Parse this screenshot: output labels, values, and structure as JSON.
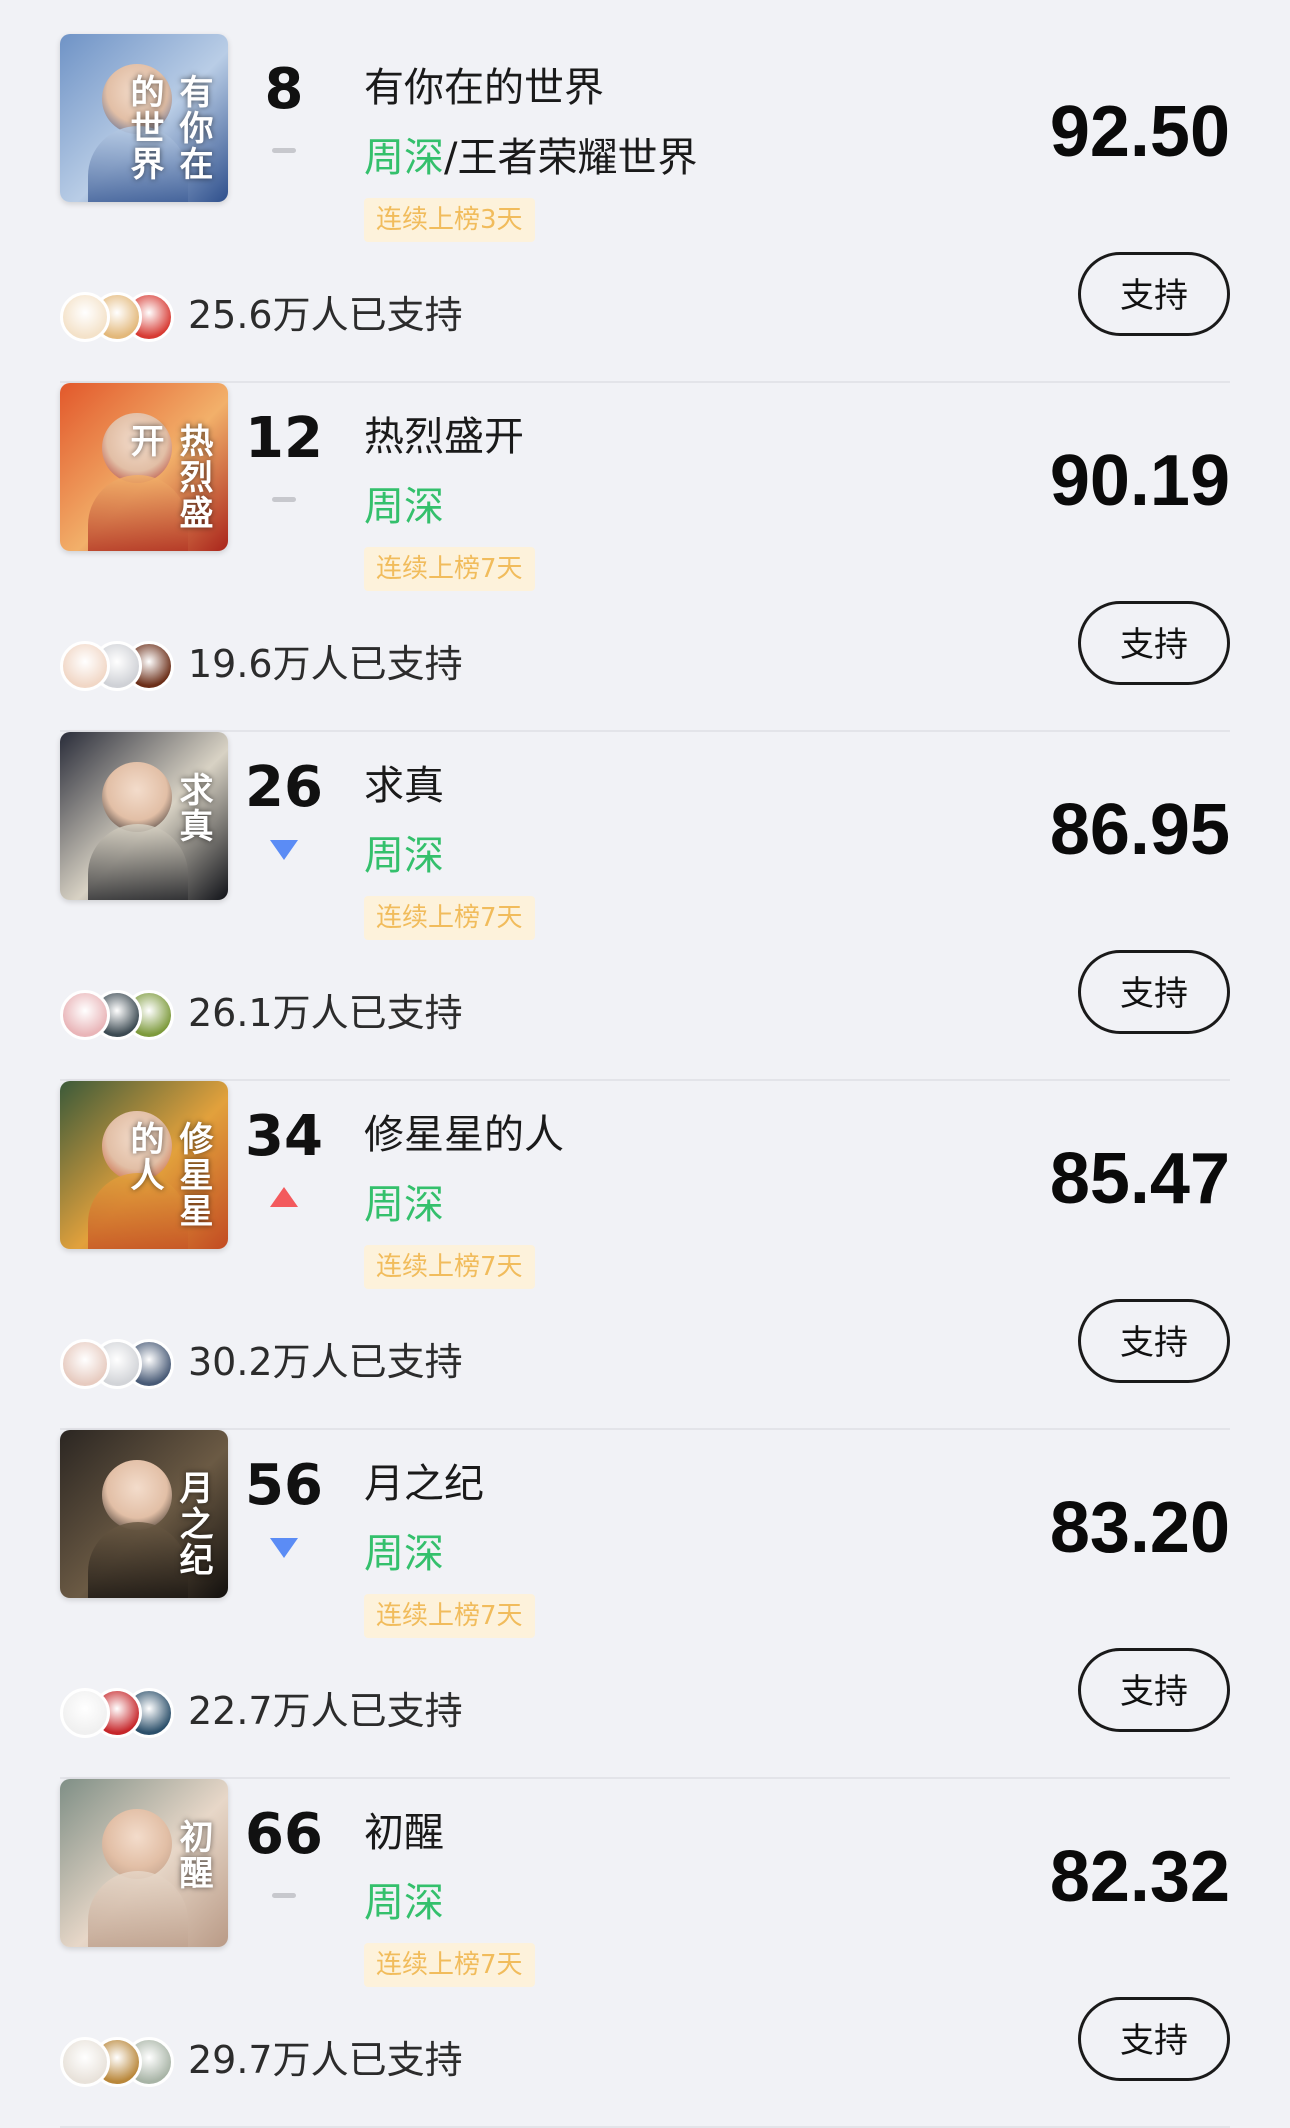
{
  "ranking": [
    {
      "rank": "8",
      "trend": "flat",
      "title": "有你在的世界",
      "artist_main": "周深",
      "artist_sep": "/",
      "artist_other": "王者荣耀世界",
      "badge": "连续上榜3天",
      "score": "92.50",
      "supporters": "25.6万人已支持",
      "button": "支持",
      "cover_title": "有你在的世界",
      "cover_colors": [
        "#6f93c6",
        "#b9cde6",
        "#2e4f8c"
      ]
    },
    {
      "rank": "12",
      "trend": "flat",
      "title": "热烈盛开",
      "artist_main": "周深",
      "artist_sep": "",
      "artist_other": "",
      "badge": "连续上榜7天",
      "score": "90.19",
      "supporters": "19.6万人已支持",
      "button": "支持",
      "cover_title": "热烈盛开",
      "cover_colors": [
        "#e2582b",
        "#f2b06a",
        "#a9241b"
      ]
    },
    {
      "rank": "26",
      "trend": "down",
      "title": "求真",
      "artist_main": "周深",
      "artist_sep": "",
      "artist_other": "",
      "badge": "连续上榜7天",
      "score": "86.95",
      "supporters": "26.1万人已支持",
      "button": "支持",
      "cover_title": "求真",
      "cover_colors": [
        "#2a2d3a",
        "#d8d2c4",
        "#101218"
      ]
    },
    {
      "rank": "34",
      "trend": "up",
      "title": "修星星的人",
      "artist_main": "周深",
      "artist_sep": "",
      "artist_other": "",
      "badge": "连续上榜7天",
      "score": "85.47",
      "supporters": "30.2万人已支持",
      "button": "支持",
      "cover_title": "修星星的人",
      "cover_colors": [
        "#3b5a3a",
        "#e2a13c",
        "#c24a22"
      ]
    },
    {
      "rank": "56",
      "trend": "down",
      "title": "月之纪",
      "artist_main": "周深",
      "artist_sep": "",
      "artist_other": "",
      "badge": "连续上榜7天",
      "score": "83.20",
      "supporters": "22.7万人已支持",
      "button": "支持",
      "cover_title": "月之纪",
      "cover_colors": [
        "#2b2622",
        "#6b5a44",
        "#120f0d"
      ]
    },
    {
      "rank": "66",
      "trend": "flat",
      "title": "初醒",
      "artist_main": "周深",
      "artist_sep": "",
      "artist_other": "",
      "badge": "连续上榜7天",
      "score": "82.32",
      "supporters": "29.7万人已支持",
      "button": "支持",
      "cover_title": "初醒",
      "cover_colors": [
        "#7f8f86",
        "#e7d7c8",
        "#b99a86"
      ]
    }
  ],
  "avatar_colors": [
    [
      "#f4e2c9",
      "#e3b87a",
      "#d73a33"
    ],
    [
      "#f1d7c6",
      "#cfd1d6",
      "#6b2e18"
    ],
    [
      "#e9b5b8",
      "#3c4a52",
      "#7d9a3c"
    ],
    [
      "#e7cbc0",
      "#d2d4d8",
      "#485a76"
    ],
    [
      "#f0f0f0",
      "#c6262a",
      "#2b4f6a"
    ],
    [
      "#e8e2da",
      "#b9873a",
      "#a8b4a6"
    ]
  ]
}
